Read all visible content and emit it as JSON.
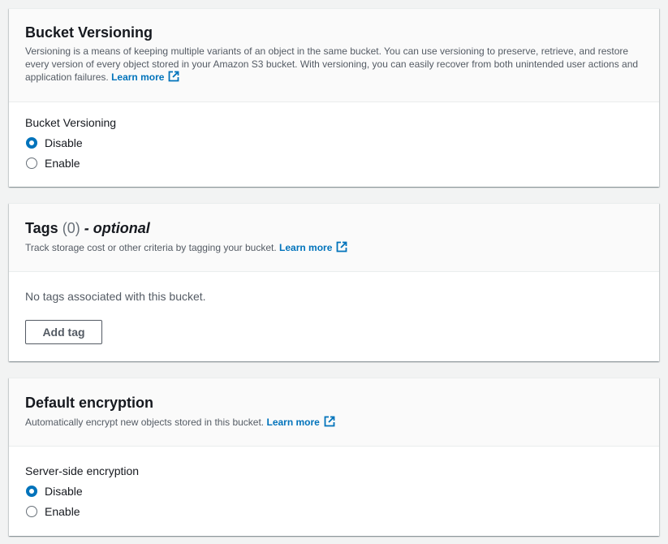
{
  "versioning": {
    "title": "Bucket Versioning",
    "description": "Versioning is a means of keeping multiple variants of an object in the same bucket. You can use versioning to preserve, retrieve, and restore every version of every object stored in your Amazon S3 bucket. With versioning, you can easily recover from both unintended user actions and application failures.",
    "learn_more": "Learn more",
    "field_label": "Bucket Versioning",
    "options": [
      {
        "label": "Disable",
        "selected": true
      },
      {
        "label": "Enable",
        "selected": false
      }
    ]
  },
  "tags": {
    "title": "Tags",
    "count": "(0)",
    "optional": "- optional",
    "description": "Track storage cost or other criteria by tagging your bucket.",
    "learn_more": "Learn more",
    "empty_text": "No tags associated with this bucket.",
    "add_button": "Add tag"
  },
  "encryption": {
    "title": "Default encryption",
    "description": "Automatically encrypt new objects stored in this bucket.",
    "learn_more": "Learn more",
    "field_label": "Server-side encryption",
    "options": [
      {
        "label": "Disable",
        "selected": true
      },
      {
        "label": "Enable",
        "selected": false
      }
    ]
  },
  "colors": {
    "link": "#0073bb",
    "radio_selected": "#0073bb",
    "page_background": "#f2f3f3"
  },
  "icons": {
    "external_link": "external-link-icon"
  }
}
